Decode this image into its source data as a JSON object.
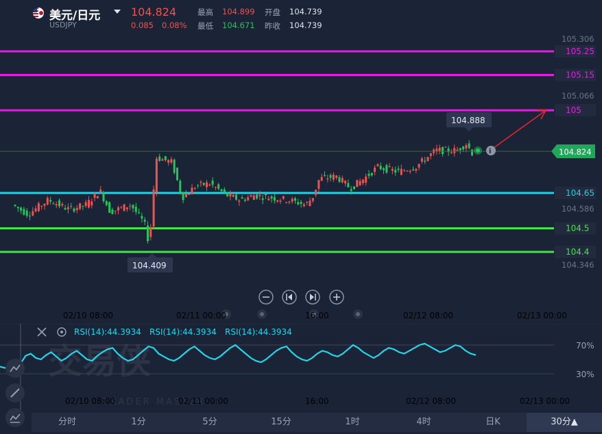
{
  "header": {
    "pair_name": "美元/日元",
    "symbol": "USDJPY",
    "price": "104.824",
    "change": "0.085",
    "change_pct": "0.08%",
    "high_label": "最高",
    "high": "104.899",
    "low_label": "最低",
    "low": "104.671",
    "open_label": "开盘",
    "open": "104.739",
    "prev_close_label": "昨收",
    "prev_close": "104.739"
  },
  "price_axis": {
    "ticks": [
      "105.306",
      "105.066",
      "104.586",
      "104.346"
    ],
    "current_price": "104.824"
  },
  "levels": [
    {
      "label": "105.25",
      "value": 105.25,
      "color": "#e020e0"
    },
    {
      "label": "105.15",
      "value": 105.15,
      "color": "#e020e0"
    },
    {
      "label": "105",
      "value": 105.0,
      "color": "#e020e0"
    },
    {
      "label": "104.65",
      "value": 104.65,
      "color": "#19d3e8"
    },
    {
      "label": "104.5",
      "value": 104.5,
      "color": "#47e34a"
    },
    {
      "label": "104.4",
      "value": 104.4,
      "color": "#47e34a"
    }
  ],
  "callouts": {
    "high": "104.888",
    "low": "104.409"
  },
  "main_dates": [
    "02/10 08:00",
    "02/11 00:00",
    "16:00",
    "02/12 08:00",
    "02/13 00:00"
  ],
  "rsi": {
    "labels": [
      "RSI(14):44.3934",
      "RSI(14):44.3934",
      "RSI(14):44.3934"
    ],
    "levels": [
      "70%",
      "30%"
    ],
    "color": "#24d6ea"
  },
  "rsi_dates": [
    "02/10 08:00",
    "02/11 00:00",
    "16:00",
    "02/12 08:00",
    "02/13 00:00"
  ],
  "watermark": {
    "cn": "交易侠",
    "en": "TRADER MASTER"
  },
  "timeframes": [
    "分时",
    "1分",
    "5分",
    "15分",
    "1时",
    "4时",
    "日K",
    "30分▲"
  ],
  "colors": {
    "up": "#ef5350",
    "down": "#26c45a",
    "background": "#1b2336"
  },
  "chart_data": {
    "type": "candlestick",
    "title": "USDJPY",
    "y_axis_range": [
      104.3,
      105.35
    ],
    "current_price": 104.824,
    "session_high": 104.899,
    "session_low": 104.671,
    "marked_high": 104.888,
    "marked_low": 104.409,
    "horizontal_levels": [
      105.25,
      105.15,
      105.0,
      104.65,
      104.5,
      104.4
    ],
    "rsi_period": 14,
    "rsi_last": 44.3934,
    "rsi_levels": [
      70,
      30
    ],
    "rsi_series": [
      40,
      38,
      41,
      39,
      44,
      55,
      58,
      52,
      50,
      56,
      60,
      54,
      48,
      52,
      58,
      62,
      56,
      50,
      48,
      55,
      60,
      64,
      66,
      58,
      52,
      48,
      50,
      56,
      62,
      68,
      66,
      58,
      54,
      50,
      48,
      52,
      58,
      64,
      68,
      62,
      56,
      52,
      50,
      54,
      60,
      66,
      70,
      64,
      58,
      52,
      48,
      46,
      50,
      56,
      62,
      66,
      68,
      60,
      54,
      50,
      48,
      52,
      58,
      62,
      60,
      56,
      54,
      58,
      64,
      70,
      66,
      60,
      56,
      52,
      56,
      62,
      66,
      64,
      60,
      58,
      62,
      66,
      70,
      72,
      68,
      64,
      60,
      62,
      66,
      70,
      68,
      62,
      58,
      56
    ]
  }
}
